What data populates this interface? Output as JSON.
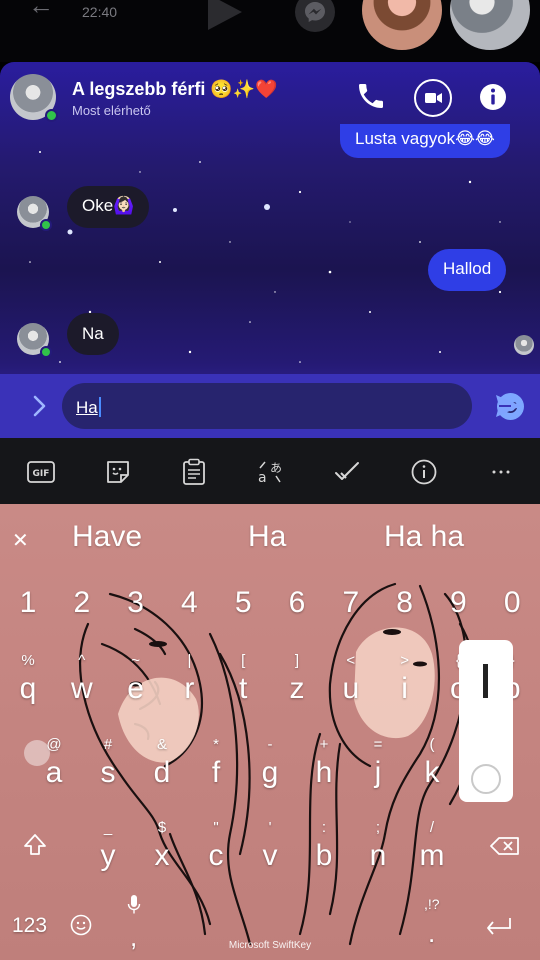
{
  "status": {
    "time": "22:40"
  },
  "chat": {
    "contact_name": "A legszebb férfi 🥺✨❤️",
    "contact_status": "Most elérhető",
    "messages": [
      {
        "text": "Lusta vagyok😂😂",
        "direction": "out"
      },
      {
        "text": "Oke🙆🏻‍♀️",
        "direction": "in"
      },
      {
        "text": "Hallod",
        "direction": "out"
      },
      {
        "text": "Na",
        "direction": "in"
      }
    ],
    "input_value": "Ha"
  },
  "keyboard": {
    "suggestions": [
      "Have",
      "Ha",
      "Ha ha"
    ],
    "number_row": [
      "1",
      "2",
      "3",
      "4",
      "5",
      "6",
      "7",
      "8",
      "9",
      "0"
    ],
    "row1": [
      {
        "main": "q",
        "alt": "%"
      },
      {
        "main": "w",
        "alt": "^"
      },
      {
        "main": "e",
        "alt": "~"
      },
      {
        "main": "r",
        "alt": "|"
      },
      {
        "main": "t",
        "alt": "["
      },
      {
        "main": "z",
        "alt": "]"
      },
      {
        "main": "u",
        "alt": "<"
      },
      {
        "main": "i",
        "alt": ">"
      },
      {
        "main": "o",
        "alt": "{"
      },
      {
        "main": "p",
        "alt": "}"
      }
    ],
    "row2": [
      {
        "main": "a",
        "alt": "@"
      },
      {
        "main": "s",
        "alt": "#"
      },
      {
        "main": "d",
        "alt": "&"
      },
      {
        "main": "f",
        "alt": "*"
      },
      {
        "main": "g",
        "alt": "-"
      },
      {
        "main": "h",
        "alt": "+"
      },
      {
        "main": "j",
        "alt": "="
      },
      {
        "main": "k",
        "alt": "("
      },
      {
        "main": "l",
        "alt": ")"
      }
    ],
    "row3": [
      {
        "main": "y",
        "alt": "_"
      },
      {
        "main": "x",
        "alt": "$"
      },
      {
        "main": "c",
        "alt": "\""
      },
      {
        "main": "v",
        "alt": "'"
      },
      {
        "main": "b",
        "alt": ":"
      },
      {
        "main": "n",
        "alt": ";"
      },
      {
        "main": "m",
        "alt": "/"
      }
    ],
    "numbers_label": "123",
    "comma": ",",
    "period": ".",
    "period_alt": ",!?",
    "brand": "Microsoft SwiftKey"
  },
  "toolbar": {
    "gif_label": "GIF"
  },
  "colors": {
    "sent_bubble": "#2f3ee6",
    "received_bubble": "#1c1a2a",
    "chat_accent": "#3a32b8",
    "keyboard_bg": "#c98a86"
  }
}
